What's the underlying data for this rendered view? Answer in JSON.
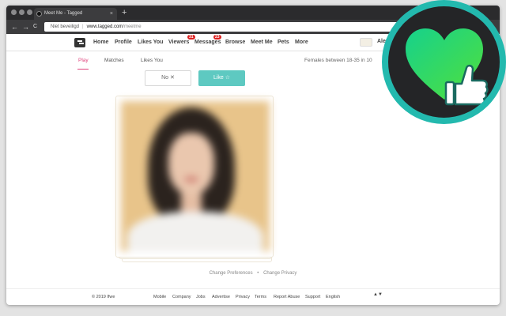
{
  "browser": {
    "tab_title": "Meet Me - Tagged",
    "tab_close": "×",
    "new_tab": "+",
    "nav_back": "←",
    "nav_forward": "→",
    "nav_reload": "C",
    "security_label": "Niet beveiligd",
    "url_host": "www.tagged.com",
    "url_path": "/meetme"
  },
  "site_nav": {
    "items": [
      {
        "label": "Home"
      },
      {
        "label": "Profile"
      },
      {
        "label": "Likes You"
      },
      {
        "label": "Viewers",
        "badge": "31"
      },
      {
        "label": "Messages",
        "badge": "23"
      },
      {
        "label": "Browse"
      },
      {
        "label": "Meet Me"
      },
      {
        "label": "Pets"
      },
      {
        "label": "More"
      }
    ],
    "username": "Alex"
  },
  "sub_tabs": {
    "items": [
      {
        "label": "Play",
        "active": true
      },
      {
        "label": "Matches"
      },
      {
        "label": "Likes You"
      }
    ],
    "filter_info": "Females between 18-35 in 10"
  },
  "actions": {
    "no_label": "No ✕",
    "like_label": "Like ☆"
  },
  "footer": {
    "links_top": [
      "Change Preferences",
      "•",
      "Change Privacy"
    ],
    "copyright": "© 2019 Ifwe",
    "links": [
      "Mobile",
      "Company",
      "Jobs",
      "Advertise",
      "Privacy",
      "Terms",
      "Report Abuse",
      "Support",
      "English"
    ],
    "language_toggle": "▲▼"
  },
  "colors": {
    "accent_pink": "#e0447d",
    "like_teal": "#5ec9c1",
    "badge_ring": "#23b9ae",
    "heart_green_top": "#16d18c",
    "heart_green_bottom": "#52e03a"
  },
  "icons": {
    "logo": "tagged-logo-icon",
    "heart_badge": "heart-thumbs-up-icon"
  }
}
